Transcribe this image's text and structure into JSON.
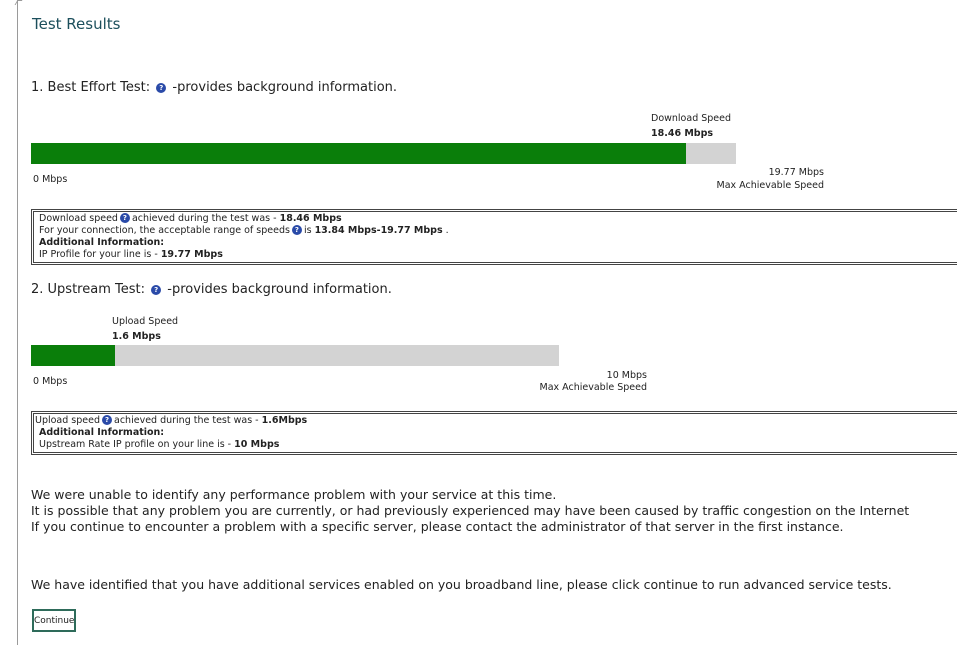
{
  "title": "Test Results",
  "best_effort": {
    "heading_prefix": "1. Best Effort Test:",
    "heading_suffix": "-provides background information.",
    "download_label": "Download Speed",
    "download_value": "18.46 Mbps",
    "min_label": "0 Mbps",
    "max_value": "19.77 Mbps",
    "max_label": "Max Achievable Speed",
    "progress_fraction": 0.929,
    "info": {
      "line1_prefix": "Download speed",
      "line1_mid": "achieved during the test was -",
      "line1_value": "18.46 Mbps",
      "line2_prefix": "For your connection, the acceptable range of speeds",
      "line2_mid": "is",
      "line2_value": "13.84 Mbps-19.77 Mbps",
      "line2_end": ".",
      "additional": "Additional Information:",
      "line4_prefix": "IP Profile for your line is -",
      "line4_value": "19.77 Mbps"
    }
  },
  "upstream": {
    "heading_prefix": "2. Upstream Test:",
    "heading_suffix": "-provides background information.",
    "upload_label": "Upload Speed",
    "upload_value": "1.6 Mbps",
    "min_label": "0 Mbps",
    "max_value": "10 Mbps",
    "max_label": "Max Achievable Speed",
    "progress_fraction": 0.16,
    "info": {
      "line1_prefix": "Upload speed",
      "line1_mid": "achieved during the test was -",
      "line1_value": "1.6Mbps",
      "additional": "Additional Information:",
      "line3_prefix": "Upstream Rate IP profile on your line is -",
      "line3_value": "10 Mbps"
    }
  },
  "message": {
    "line1": "We were unable to identify any performance problem with your service at this time.",
    "line2": "It is possible that any problem you are currently, or had previously experienced may have been caused by traffic congestion on the Internet",
    "line3": "If you continue to encounter a problem with a specific server, please contact the administrator of that server in the first instance."
  },
  "additional_services": "We have identified that you have additional services enabled on you broadband line, please click continue to run advanced service tests.",
  "continue_label": "Continue",
  "colors": {
    "fill": "#0a7e0a",
    "track": "#d3d3d3",
    "title": "#1c4f5c",
    "help_icon": "#2a4aa8"
  }
}
